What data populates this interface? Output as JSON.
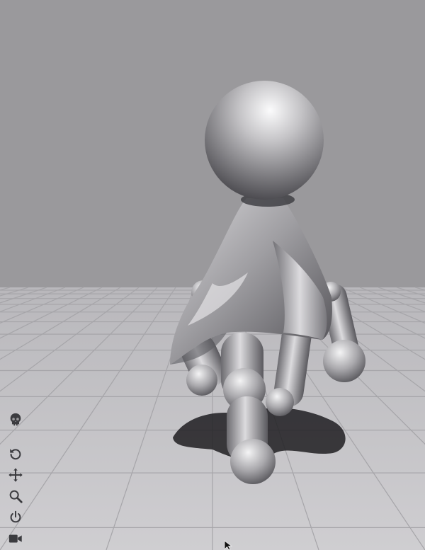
{
  "scene": {
    "colors": {
      "sky": "#9a999c",
      "floor": "#c9c8cb",
      "grid": "#a6a5a9",
      "figure": "#c8c7ca",
      "shadow": "#1e1d21"
    }
  },
  "toolbar": {
    "items": [
      {
        "icon": "skull-icon"
      },
      {
        "icon": "reset-icon"
      },
      {
        "icon": "move-icon"
      },
      {
        "icon": "zoom-icon"
      },
      {
        "icon": "power-icon"
      },
      {
        "icon": "camera-icon"
      }
    ]
  }
}
